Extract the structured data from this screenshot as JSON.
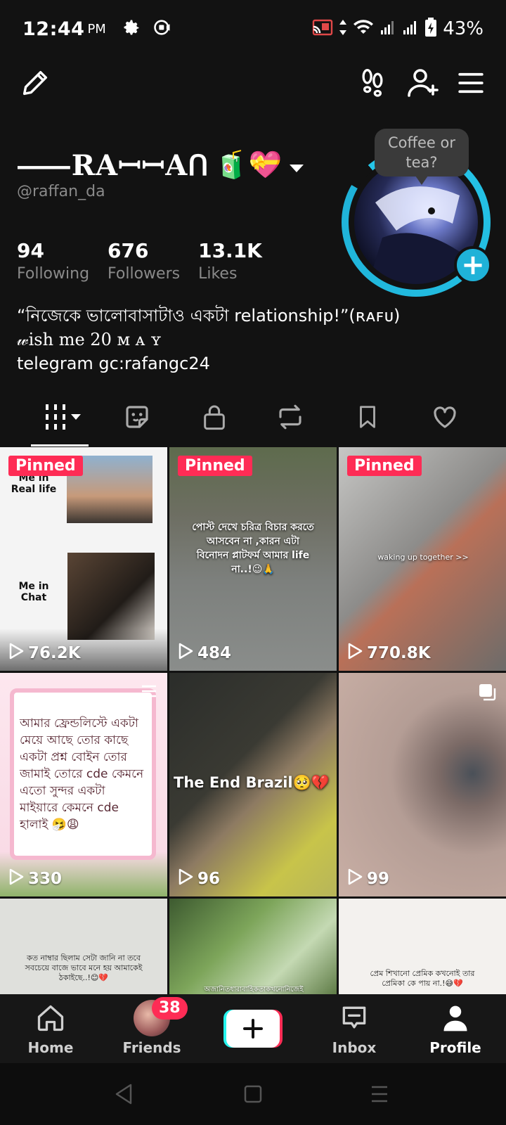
{
  "status_bar": {
    "time": "12:44",
    "ampm": "PM",
    "battery": "43%",
    "icons": [
      "settings-icon",
      "record-icon",
      "cast-icon",
      "data-arrows-icon",
      "wifi-icon",
      "signal-icon",
      "signal-icon",
      "battery-charging-icon"
    ]
  },
  "top_bar": {
    "icons": [
      "edit-pencil-icon",
      "footprints-icon",
      "add-friend-icon",
      "menu-icon"
    ]
  },
  "profile": {
    "name": "⸺RAꟷꟷAᑎ",
    "name_emoji": "🧃💝",
    "handle": "@raffan_da",
    "bubble_text": "Coffee or tea?",
    "stats": [
      {
        "num": "94",
        "label": "Following"
      },
      {
        "num": "676",
        "label": "Followers"
      },
      {
        "num": "13.1K",
        "label": "Likes"
      }
    ],
    "bio_line1": "“নিজেকে ভালোবাসাটাও একটা relationship!”(ʀᴀꜰᴜ)",
    "bio_line2": "𝓌ish me 20 ᴍ ᴀ ʏ",
    "bio_line3": "telegram gc:rafangc24"
  },
  "tabs": [
    "videos-grid-icon",
    "reposts-face-icon",
    "private-lock-icon",
    "repost-icon",
    "bookmark-icon",
    "liked-heart-icon"
  ],
  "videos": [
    {
      "pinned": "Pinned",
      "views": "76.2K",
      "caption_top": "Me in Real life",
      "caption_bottom": "Me in Chat",
      "bg": "#f4f4f4"
    },
    {
      "pinned": "Pinned",
      "views": "484",
      "caption": "পোস্ট দেখে চরিত্র বিচার করতে আসবেন না ,কারন এটা বিনোদন প্লাটফর্ম আমার life না..!😉🙏",
      "bg": "#4d5650"
    },
    {
      "pinned": "Pinned",
      "views": "770.8K",
      "caption": "waking up together >>",
      "bg": "#8c8d8e"
    },
    {
      "views": "330",
      "caption": "আমার ফ্রেন্ডলিস্টে একটা মেয়ে আছে তোর কাছে একটা প্রশ্ন বোইন তোর জামাই তোরে cde কেমনে এতো সুন্দর একটা মাইয়ারে কেমনে cde হালাই 🤧😩",
      "bg": "#fde7ef"
    },
    {
      "views": "96",
      "caption": "The End Brazil🥺💔",
      "bg": "#2a2f2a"
    },
    {
      "views": "99",
      "bg": "#b19a93"
    },
    {
      "caption": "কত নাম্বার ছিলাম সেটা জানি না তবে সবচেয়ে বাজে ভাবে মনে হয় আমাকেই ঠকাইছে..!😊💔",
      "bg": "#dfe0dc"
    },
    {
      "caption": "অজানিতধারাবাহিকতাকখনোনিজেই",
      "bg": "#5d7a44"
    },
    {
      "caption": "প্রেম শিখানো প্রেমিক কখনোই তার প্রেমিকা কে পায় না.!😅💔",
      "bg": "#f3f1ee"
    }
  ],
  "bottom_nav": {
    "home": "Home",
    "friends": "Friends",
    "friends_badge": "38",
    "inbox": "Inbox",
    "profile": "Profile"
  },
  "colors": {
    "accent": "#fe2c55",
    "ring": "#25c5e8",
    "background": "#121212"
  }
}
